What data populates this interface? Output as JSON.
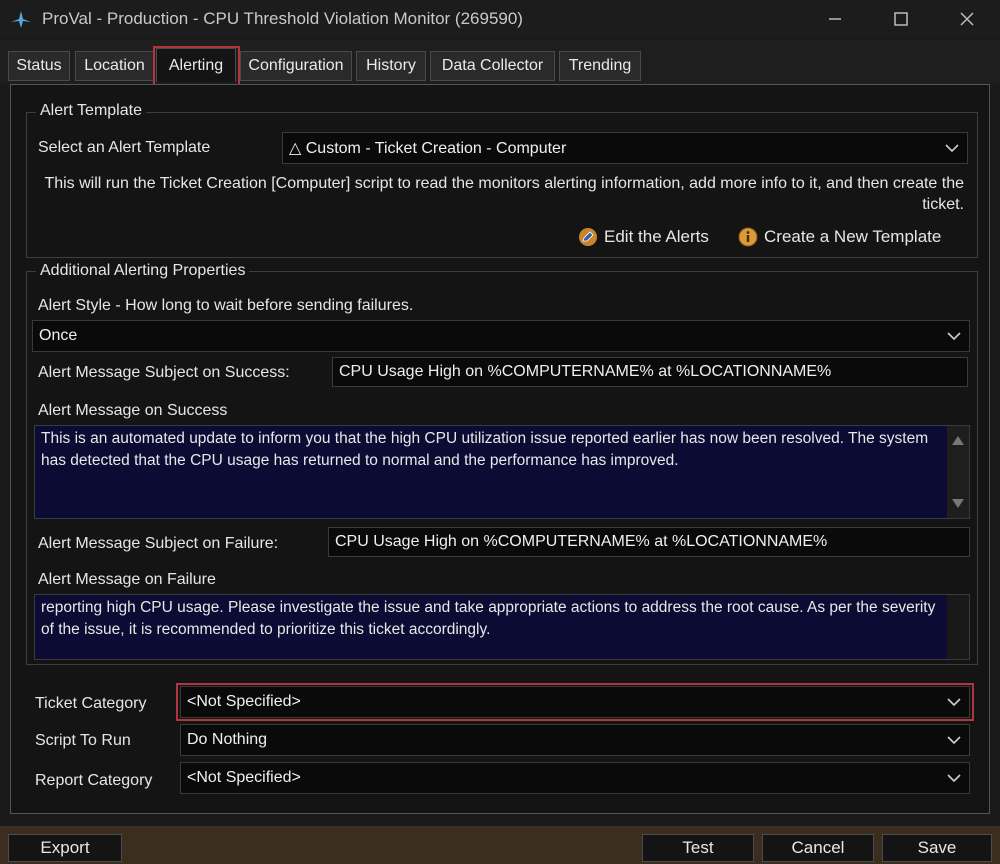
{
  "window": {
    "title": "ProVal - Production - CPU Threshold Violation Monitor (269590)",
    "controls": [
      "minimize",
      "maximize",
      "close"
    ]
  },
  "tabs": [
    {
      "label": "Status",
      "active": false
    },
    {
      "label": "Location",
      "active": false
    },
    {
      "label": "Alerting",
      "active": true
    },
    {
      "label": "Configuration",
      "active": false
    },
    {
      "label": "History",
      "active": false
    },
    {
      "label": "Data Collector",
      "active": false
    },
    {
      "label": "Trending",
      "active": false
    }
  ],
  "alert_template": {
    "group_title": "Alert Template",
    "select_label": "Select an Alert Template",
    "selected": "△ Custom - Ticket Creation - Computer",
    "description": "This will run the Ticket Creation [Computer] script to read the monitors alerting information, add more info to it, and then create the ticket.",
    "edit_label": "Edit the Alerts",
    "create_label": "Create a New Template"
  },
  "additional": {
    "group_title": "Additional Alerting Properties",
    "style_label": "Alert Style - How long to wait before sending failures.",
    "style_value": "Once",
    "success_subject_label": "Alert Message Subject on Success:",
    "success_subject_value": "CPU Usage High on %COMPUTERNAME% at %LOCATIONNAME%",
    "success_message_label": "Alert Message on Success",
    "success_message": "This is an automated update to inform you that the high CPU utilization issue reported earlier has now been resolved. The system has detected that the CPU usage has returned to normal and the performance has improved.",
    "failure_subject_label": "Alert Message Subject on Failure:",
    "failure_subject_value": "CPU Usage High on %COMPUTERNAME% at %LOCATIONNAME%",
    "failure_message_label": "Alert Message on Failure",
    "failure_message": "reporting high CPU usage. Please investigate the issue and take appropriate actions to address the root cause. As per the severity of the issue, it is recommended to prioritize this ticket accordingly."
  },
  "ticket_category": {
    "label": "Ticket Category",
    "value": "<Not Specified>"
  },
  "script_to_run": {
    "label": "Script To Run",
    "value": "Do Nothing"
  },
  "report_category": {
    "label": "Report Category",
    "value": "<Not Specified>"
  },
  "footer": {
    "export": "Export",
    "test": "Test",
    "cancel": "Cancel",
    "save": "Save"
  },
  "colors": {
    "highlight": "#b0353f",
    "memo_background": "#0b0b33",
    "footer_background": "#3c2e1f"
  }
}
